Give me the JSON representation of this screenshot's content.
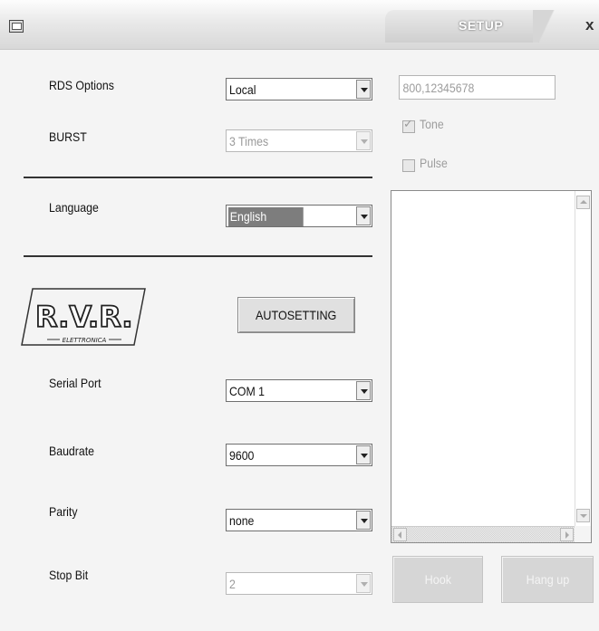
{
  "window": {
    "tab_label": "SETUP",
    "close_glyph": "x",
    "app_icon": "window-icon"
  },
  "rds": {
    "label": "RDS Options",
    "value": "Local"
  },
  "burst": {
    "label": "BURST",
    "value": "3 Times",
    "enabled": false
  },
  "language": {
    "label": "Language",
    "value": "English"
  },
  "logo": {
    "text": "R.V.R.",
    "subtext": "ELETTRONICA"
  },
  "autosetting": {
    "label": "AUTOSETTING"
  },
  "serial_port": {
    "label": "Serial Port",
    "value": "COM 1"
  },
  "baudrate": {
    "label": "Baudrate",
    "value": "9600"
  },
  "parity": {
    "label": "Parity",
    "value": "none"
  },
  "stop_bit": {
    "label": "Stop Bit",
    "value": "2",
    "enabled": false
  },
  "phone": {
    "number": "800,12345678",
    "tone_label": "Tone",
    "tone_checked": true,
    "pulse_label": "Pulse",
    "pulse_checked": false
  },
  "buttons": {
    "hook": "Hook",
    "hang_up": "Hang up"
  },
  "colors": {
    "window_bg": "#f4f4f4",
    "selected_bg": "#7d7d7d",
    "disabled_text": "#9d9d9d"
  }
}
